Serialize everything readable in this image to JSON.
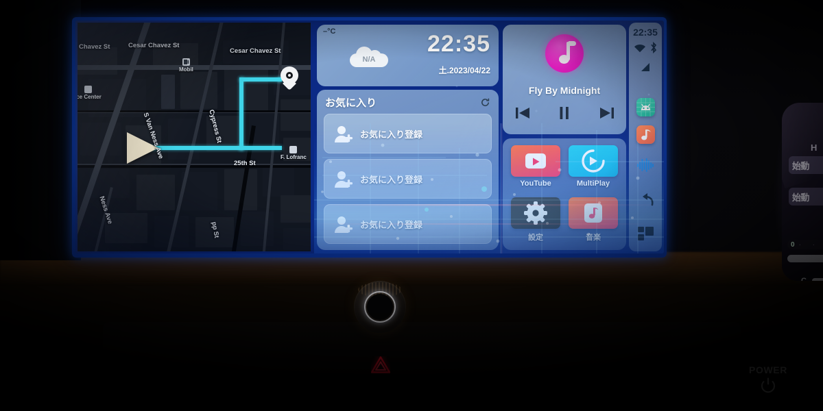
{
  "scene": {
    "description": "car-infotainment-head-unit-dashboard"
  },
  "map": {
    "street_labels": [
      "Chavez St",
      "Cesar Chavez St",
      "Cesar Chavez St",
      "S Van Ness Ave",
      "Cypress St",
      "Ness Ave",
      "S Va",
      "Cypres",
      "25th St",
      "pp St"
    ],
    "pois": [
      {
        "name": "Mobil",
        "icon": "gas-station-icon"
      },
      {
        "name": "ice Center",
        "icon": "building-icon"
      },
      {
        "name": "F. Lofranc",
        "icon": "building-icon"
      }
    ],
    "route_color": "#3fd4e8",
    "vehicle_marker": "navigation-arrow",
    "destination_marker": "map-pin"
  },
  "weather_widget": {
    "unit_label": "–°C",
    "condition": "N/A",
    "condition_icon": "cloud-icon",
    "time": "22:35",
    "date": "土.2023/04/22"
  },
  "favorites_widget": {
    "title": "お気に入り",
    "refresh_icon": "refresh-icon",
    "rows": [
      {
        "label": "お気に入り登録",
        "icon": "add-contact-icon"
      },
      {
        "label": "お気に入り登録",
        "icon": "add-contact-icon"
      },
      {
        "label": "お気に入り登録",
        "icon": "add-contact-icon"
      }
    ]
  },
  "media_widget": {
    "app_icon": "music-circle-icon",
    "app_icon_color": "#ef18c6",
    "track_title": "Fly By Midnight",
    "controls": [
      {
        "name": "previous",
        "icon": "skip-previous-icon"
      },
      {
        "name": "pause",
        "icon": "pause-icon"
      },
      {
        "name": "next",
        "icon": "skip-next-icon"
      }
    ]
  },
  "app_grid": {
    "apps": [
      {
        "label": "YouTube",
        "icon": "youtube-icon",
        "color": "#ff3d6e"
      },
      {
        "label": "MultiPlay",
        "icon": "multiplay-icon",
        "color": "#17b9e8"
      },
      {
        "label": "設定",
        "icon": "gear-icon",
        "color": "#2a2e34"
      },
      {
        "label": "音楽",
        "icon": "music-note-icon",
        "color": "#ff4f7d"
      }
    ]
  },
  "status_bar": {
    "time": "22:35",
    "icons": [
      "wifi-icon",
      "bluetooth-icon",
      "signal-icon"
    ],
    "apps": [
      {
        "name": "android-auto-icon",
        "color": "#21b89e"
      },
      {
        "name": "music-icon",
        "color": "#fd6a4a"
      }
    ],
    "assistant_icon": "voice-waveform-icon",
    "back_icon": "back-arrow-icon",
    "recents_icon": "recent-apps-icon"
  },
  "instrument_cluster": {
    "heading": "H",
    "buttons": [
      "始動",
      "始動"
    ],
    "gauge_zero": "0",
    "gauge_dots": "· ·",
    "temp_label": "C"
  },
  "hardware": {
    "knob": "rotary-control-knob",
    "hazard_label": "hazard-warning-button",
    "power_label": "POWER",
    "power_icon": "power-symbol-icon"
  }
}
